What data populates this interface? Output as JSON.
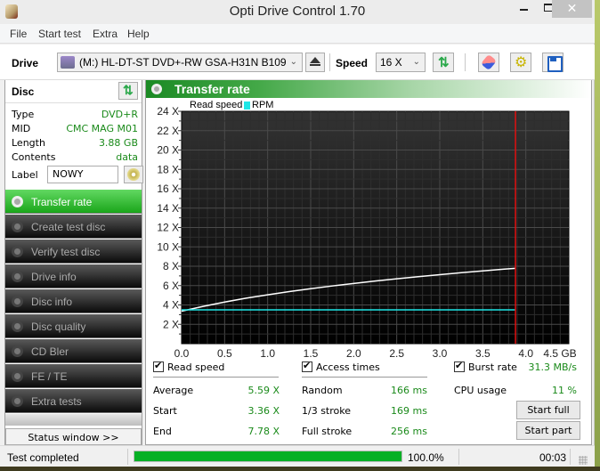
{
  "window": {
    "title": "Opti Drive Control 1.70",
    "controls": {
      "minimize": "–",
      "maximize": "□",
      "close": "✕"
    }
  },
  "menu": [
    "File",
    "Start test",
    "Extra",
    "Help"
  ],
  "toolbar": {
    "drive_label": "Drive",
    "drive_value": "(M:)   HL-DT-ST DVD+-RW GSA-H31N B109",
    "speed_label": "Speed",
    "speed_value": "16 X",
    "icons": [
      "drive-icon",
      "eject-icon",
      "refresh-icon",
      "erase-icon",
      "settings-icon",
      "save-icon"
    ]
  },
  "disc": {
    "title": "Disc",
    "rows": [
      {
        "key": "Type",
        "value": "DVD+R"
      },
      {
        "key": "MID",
        "value": "CMC MAG M01"
      },
      {
        "key": "Length",
        "value": "3.88 GB"
      },
      {
        "key": "Contents",
        "value": "data"
      }
    ],
    "label_key": "Label",
    "label_value": "NOWY"
  },
  "nav": [
    {
      "label": "Transfer rate",
      "active": true
    },
    {
      "label": "Create test disc",
      "active": false
    },
    {
      "label": "Verify test disc",
      "active": false
    },
    {
      "label": "Drive info",
      "active": false
    },
    {
      "label": "Disc info",
      "active": false
    },
    {
      "label": "Disc quality",
      "active": false
    },
    {
      "label": "CD Bler",
      "active": false
    },
    {
      "label": "FE / TE",
      "active": false
    },
    {
      "label": "Extra tests",
      "active": false
    }
  ],
  "status_window_button": "Status window >>",
  "panel": {
    "title": "Transfer rate"
  },
  "chart_data": {
    "type": "line",
    "title": "Transfer rate",
    "legend": [
      "Read speed",
      "RPM"
    ],
    "legend_placement": "top-left",
    "xlabel": "GB",
    "ylabel": "X",
    "xlim": [
      0,
      4.5
    ],
    "ylim": [
      0,
      24
    ],
    "x_ticks": [
      "0.0",
      "0.5",
      "1.0",
      "1.5",
      "2.0",
      "2.5",
      "3.0",
      "3.5",
      "4.0",
      "4.5 GB"
    ],
    "y_ticks": [
      "2 X",
      "4 X",
      "6 X",
      "8 X",
      "10 X",
      "12 X",
      "14 X",
      "16 X",
      "18 X",
      "20 X",
      "22 X",
      "24 X"
    ],
    "grid": true,
    "series": [
      {
        "name": "Read speed",
        "color": "#ffffff",
        "x": [
          0.0,
          0.25,
          0.5,
          0.75,
          1.0,
          1.25,
          1.5,
          1.75,
          2.0,
          2.25,
          2.5,
          2.75,
          3.0,
          3.25,
          3.5,
          3.75,
          3.88
        ],
        "y": [
          3.36,
          3.85,
          4.3,
          4.7,
          5.05,
          5.38,
          5.68,
          5.96,
          6.22,
          6.47,
          6.7,
          6.92,
          7.13,
          7.33,
          7.52,
          7.7,
          7.78
        ]
      },
      {
        "name": "RPM",
        "color": "#1ee6e6",
        "x": [
          0.0,
          3.88
        ],
        "y": [
          3.5,
          3.5
        ]
      }
    ],
    "marker_line": {
      "x": 3.88,
      "color": "#e01010"
    }
  },
  "stats": {
    "read_speed": {
      "label": "Read speed",
      "checked": true,
      "rows": [
        {
          "key": "Average",
          "value": "5.59 X"
        },
        {
          "key": "Start",
          "value": "3.36 X"
        },
        {
          "key": "End",
          "value": "7.78 X"
        }
      ]
    },
    "access_times": {
      "label": "Access times",
      "checked": true,
      "rows": [
        {
          "key": "Random",
          "value": "166 ms"
        },
        {
          "key": "1/3 stroke",
          "value": "169 ms"
        },
        {
          "key": "Full stroke",
          "value": "256 ms"
        }
      ]
    },
    "burst_rate": {
      "label": "Burst rate",
      "checked": true,
      "value": "31.3 MB/s"
    },
    "cpu_usage": {
      "label": "CPU usage",
      "value": "11 %"
    },
    "buttons": {
      "start_full": "Start full",
      "start_part": "Start part"
    }
  },
  "statusbar": {
    "text": "Test completed",
    "progress": 1.0,
    "progress_text": "100.0%",
    "elapsed": "00:03"
  }
}
